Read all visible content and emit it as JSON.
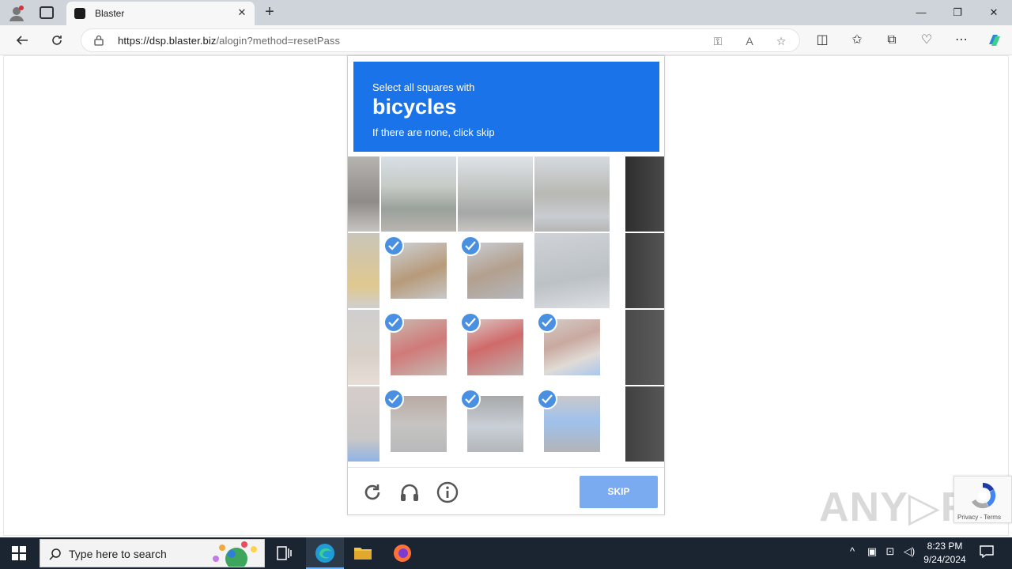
{
  "browser": {
    "tab_title": "Blaster",
    "url_host": "https://dsp.blaster.biz",
    "url_path": "/alogin?method=resetPass"
  },
  "captcha": {
    "instruction_line1": "Select all squares with",
    "target": "bicycles",
    "instruction_line3": "If there are none, click skip",
    "skip_label": "SKIP",
    "selected_tiles": [
      [
        1,
        0
      ],
      [
        1,
        1
      ],
      [
        2,
        0
      ],
      [
        2,
        1
      ],
      [
        2,
        2
      ],
      [
        3,
        0
      ],
      [
        3,
        1
      ],
      [
        3,
        2
      ]
    ]
  },
  "recaptcha": {
    "terms": "Privacy - Terms"
  },
  "watermark": "ANY.RUN",
  "taskbar": {
    "search_placeholder": "Type here to search",
    "time": "8:23 PM",
    "date": "9/24/2024"
  },
  "colors": {
    "banner": "#1a73e8",
    "skip": "#7aaaf0",
    "check": "#4a90e2",
    "taskbar": "#1b2532"
  }
}
